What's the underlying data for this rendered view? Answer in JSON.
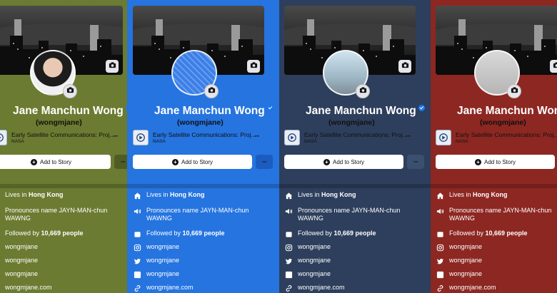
{
  "profile": {
    "name": "Jane Manchun Wong",
    "handle": "(wongmjane)",
    "work_title": "Early Satellite Communications: Proj...",
    "work_subtitle": "NASA",
    "add_story_label": "Add to Story",
    "more_label": "···",
    "work_more_label": "···"
  },
  "about": {
    "lives_prefix": "Lives in ",
    "lives_city": "Hong Kong",
    "pronounce_line1": "Pronounces name JAYN-MAN-chun",
    "pronounce_line2": "WAWNG",
    "followed_prefix": "Followed by ",
    "followed_count": "10,669 people",
    "instagram": "wongmjane",
    "twitter": "wongmjane",
    "linkedin": "wongmjane",
    "website": "wongmjane.com"
  },
  "themes": [
    {
      "name": "olive",
      "background": "#6b7b31",
      "text": "#ffffff",
      "button": "#4f5c24"
    },
    {
      "name": "blue",
      "background": "#2574e0",
      "text": "#ffffff",
      "button": "#1a5cc0"
    },
    {
      "name": "navy",
      "background": "#2d3f5c",
      "text": "#ffffff",
      "button": "#3b4f70"
    },
    {
      "name": "red",
      "background": "#8d2722",
      "text": "#ffffff",
      "button": "#a0322c"
    }
  ],
  "icons": [
    "camera-icon",
    "verified-badge-icon",
    "home-icon",
    "speaker-icon",
    "followers-icon",
    "instagram-icon",
    "twitter-icon",
    "linkedin-icon",
    "link-icon",
    "plus-icon"
  ]
}
